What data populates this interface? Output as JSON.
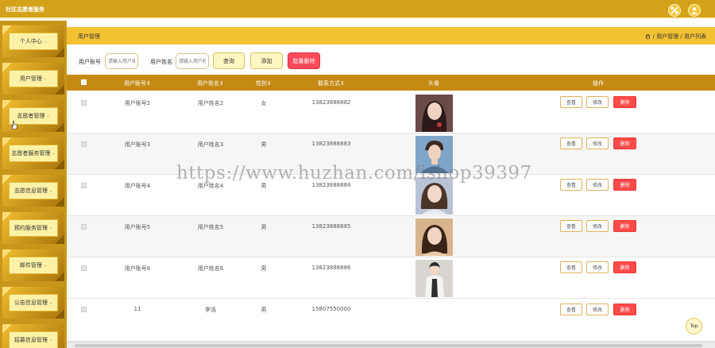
{
  "app": {
    "title": "社区志愿者服务",
    "icons": [
      "fullscreen-icon",
      "user-icon"
    ],
    "accent": "#d4a21a"
  },
  "sidebar": {
    "items": [
      {
        "label": "个人中心"
      },
      {
        "label": "用户管理"
      },
      {
        "label": "志愿者管理"
      },
      {
        "label": "志愿者服务管理"
      },
      {
        "label": "志愿信息管理"
      },
      {
        "label": "预约服务管理"
      },
      {
        "label": "邮件管理"
      },
      {
        "label": "公告信息管理"
      },
      {
        "label": "招募信息管理"
      }
    ],
    "caret": "⌄"
  },
  "header": {
    "page_title": "用户管理",
    "breadcrumb": "/ 用户管理 / 用户列表"
  },
  "search": {
    "account_label": "用户账号",
    "account_placeholder": "请输入用户账号",
    "name_label": "用户姓名",
    "name_placeholder": "请输入用户姓名",
    "query_button": "查询",
    "add_button": "添加",
    "batch_delete_button": "批量删除"
  },
  "table": {
    "columns": [
      "用户账号⇕",
      "用户姓名⇕",
      "性别⇕",
      "联系方式⇕",
      "头像",
      "操作"
    ],
    "rows": [
      {
        "account": "用户账号2",
        "name": "用户姓名2",
        "gender": "女",
        "phone": "13823888882",
        "avatar": "female-portrait"
      },
      {
        "account": "用户账号3",
        "name": "用户姓名3",
        "gender": "男",
        "phone": "13823888883",
        "avatar": "male-portrait"
      },
      {
        "account": "用户账号4",
        "name": "用户姓名4",
        "gender": "男",
        "phone": "13823888884",
        "avatar": "female-portrait"
      },
      {
        "account": "用户账号5",
        "name": "用户姓名5",
        "gender": "男",
        "phone": "13823888885",
        "avatar": "female-portrait"
      },
      {
        "account": "用户账号6",
        "name": "用户姓名6",
        "gender": "男",
        "phone": "13823888886",
        "avatar": "female-portrait"
      },
      {
        "account": "11",
        "name": "李浩",
        "gender": "男",
        "phone": "15807550000",
        "avatar": ""
      }
    ],
    "actions": {
      "view": "查看",
      "edit": "修改",
      "delete": "删除"
    }
  },
  "watermark": "https://www.huzhan.com/ishop39397",
  "top_button": "Top"
}
